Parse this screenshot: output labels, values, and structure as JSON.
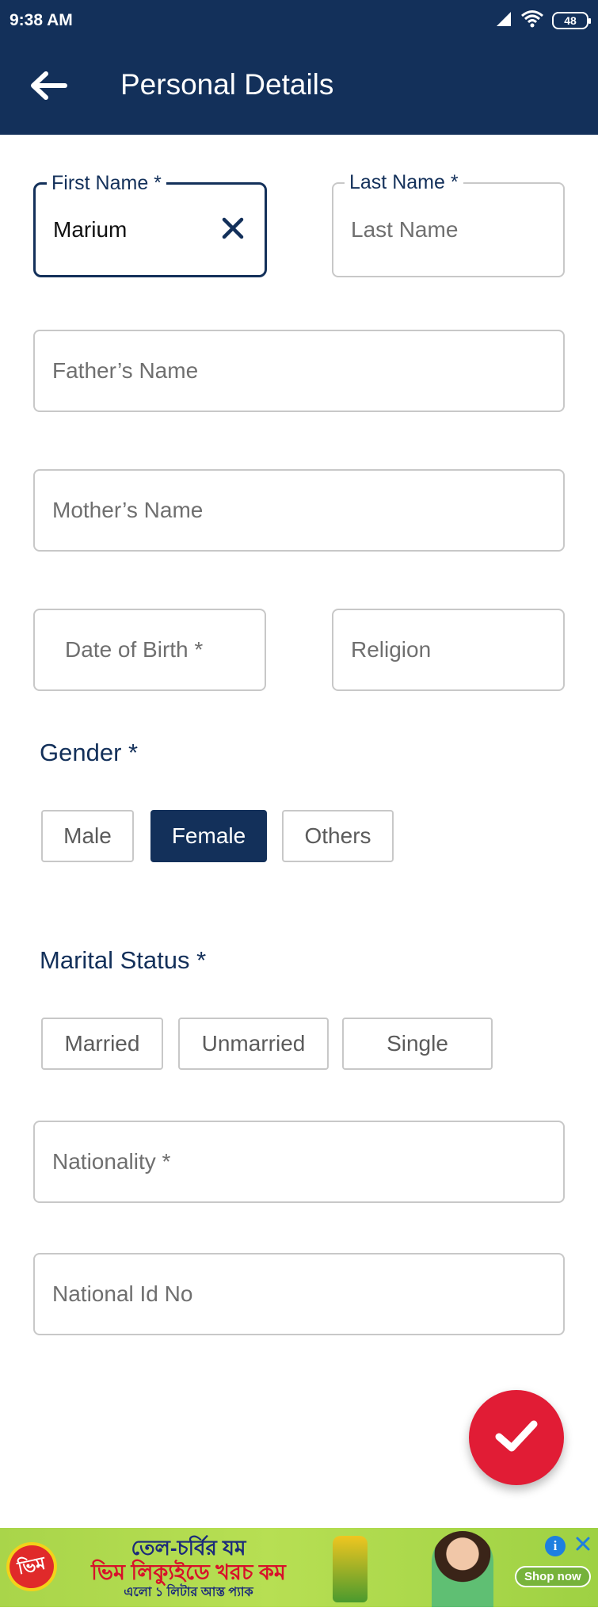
{
  "status_bar": {
    "time": "9:38 AM",
    "battery": "48",
    "icons": [
      "signal-icon",
      "wifi-icon",
      "battery-icon"
    ]
  },
  "app_bar": {
    "back_icon": "arrow-left-icon",
    "title": "Personal Details"
  },
  "form": {
    "first_name": {
      "label": "First Name *",
      "value": "Marium",
      "clear_icon": "close-icon"
    },
    "last_name": {
      "label": "Last Name *",
      "placeholder": "Last Name"
    },
    "fathers_name": {
      "placeholder": "Father’s Name"
    },
    "mothers_name": {
      "placeholder": "Mother’s Name"
    },
    "date_of_birth": {
      "placeholder": "Date of Birth *"
    },
    "religion": {
      "placeholder": "Religion"
    },
    "gender": {
      "label": "Gender *",
      "options": [
        "Male",
        "Female",
        "Others"
      ],
      "selected": "Female"
    },
    "marital_status": {
      "label": "Marital Status *",
      "options": [
        "Married",
        "Unmarried",
        "Single"
      ],
      "selected": ""
    },
    "nationality": {
      "placeholder": "Nationality *"
    },
    "national_id": {
      "placeholder": "National Id No"
    }
  },
  "submit_button": {
    "icon": "checkmark-icon"
  },
  "ad_banner": {
    "brand": "ভিম",
    "line1": "তেল-চর্বির যম",
    "line2": "ভিম লিক্যুইডে খরচ কম",
    "line3": "এলো ১ লিটার আস্ত প্যাক",
    "cta": "Shop now",
    "info_icon": "info-icon",
    "close_icon": "close-icon"
  },
  "colors": {
    "primary": "#13305a",
    "accent": "#e11c35",
    "border": "#c8c8c8",
    "placeholder_text": "#6f6f6f"
  }
}
